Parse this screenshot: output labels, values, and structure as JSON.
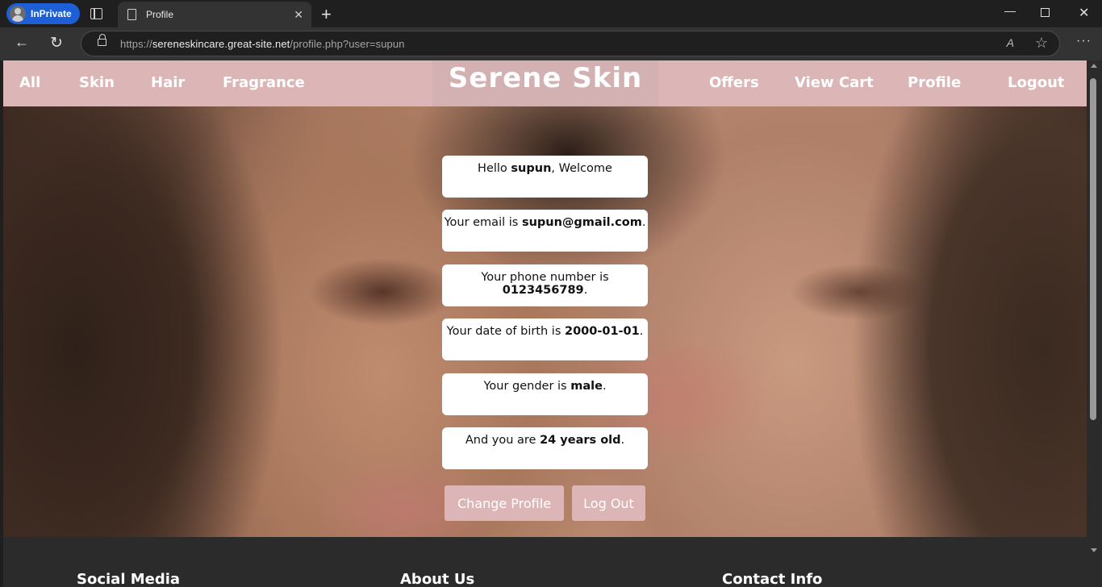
{
  "browser": {
    "inprivate_label": "InPrivate",
    "tab_title": "Profile",
    "close_tab": "✕",
    "new_tab": "+",
    "url_prefix": "https://",
    "url_host": "sereneskincare.great-site.net",
    "url_path": "/profile.php?user=supun",
    "win_minimize": "—",
    "win_close": "✕",
    "back": "←",
    "reload": "↻",
    "more": "···",
    "read_aloud": "A",
    "favorite": "☆"
  },
  "nav": {
    "left": [
      "All",
      "Skin",
      "Hair",
      "Fragrance"
    ],
    "logo": "Serene Skin",
    "right": [
      "Offers",
      "View Cart",
      "Profile",
      "Logout"
    ]
  },
  "profile": {
    "greeting": {
      "pre": "Hello ",
      "value": "supun",
      "post": ", Welcome"
    },
    "email": {
      "pre": "Your email is ",
      "value": "supun@gmail.com",
      "post": "."
    },
    "phone": {
      "pre": "Your phone number is ",
      "value": "0123456789",
      "post": "."
    },
    "dob": {
      "pre": "Your date of birth is ",
      "value": "2000-01-01",
      "post": "."
    },
    "gender": {
      "pre": "Your gender is ",
      "value": "male",
      "post": "."
    },
    "age": {
      "pre": "And you are ",
      "value": "24 years old",
      "post": "."
    }
  },
  "buttons": {
    "change_profile": "Change Profile",
    "log_out": "Log Out"
  },
  "footer": {
    "social": "Social Media",
    "about": "About Us",
    "contact": "Contact Info"
  },
  "colors": {
    "navbar": "#dcb6b6",
    "button": "#dcb6b6",
    "page_bg": "#2b2b2b"
  }
}
